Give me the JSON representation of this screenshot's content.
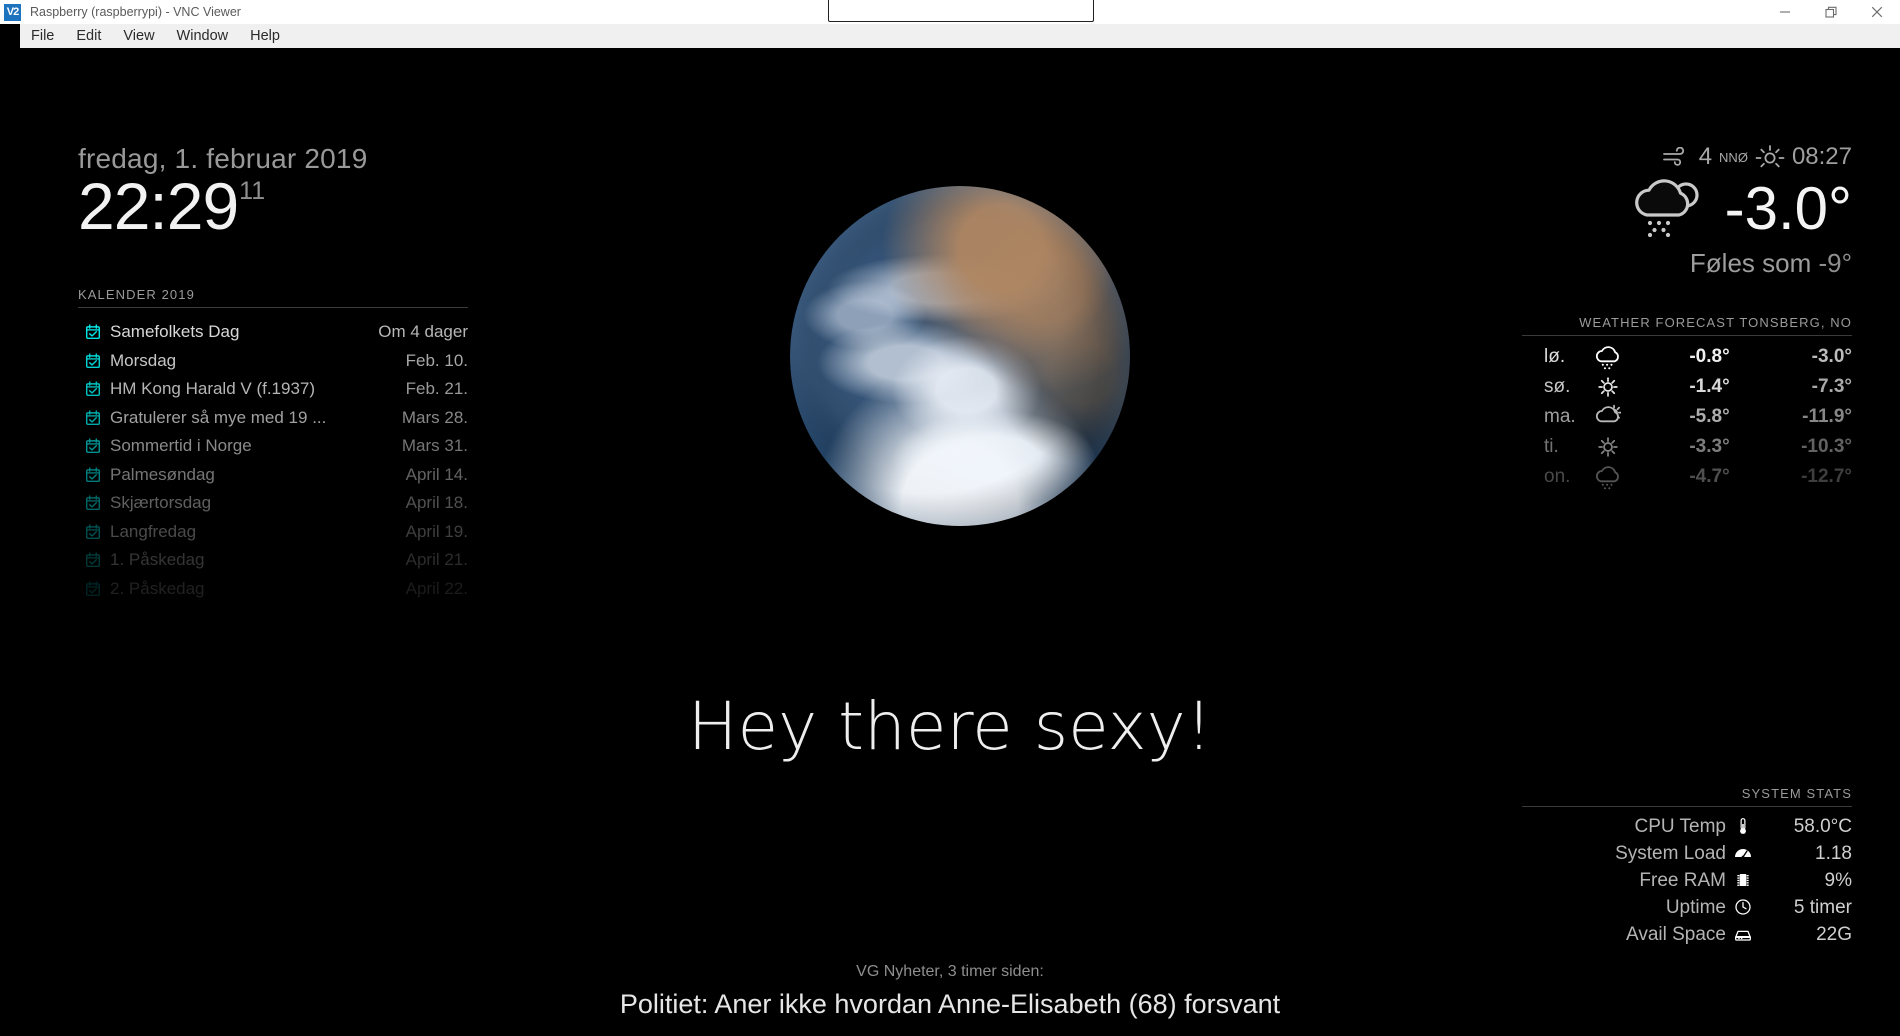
{
  "window": {
    "logo_text": "V2",
    "title": "Raspberry (raspberrypi) - VNC Viewer",
    "controls": {
      "minimize": "minimize-icon",
      "restore": "restore-icon",
      "close": "close-icon"
    },
    "menu": [
      "File",
      "Edit",
      "View",
      "Window",
      "Help"
    ]
  },
  "clock": {
    "date": "fredag, 1. februar 2019",
    "time": "22:29",
    "seconds": "11"
  },
  "calendar": {
    "heading": "KALENDER 2019",
    "events": [
      {
        "title": "Samefolkets Dag",
        "when": "Om 4 dager",
        "opacity": 1.0
      },
      {
        "title": "Morsdag",
        "when": "Feb. 10.",
        "opacity": 0.92
      },
      {
        "title": "HM Kong Harald V (f.1937)",
        "when": "Feb. 21.",
        "opacity": 0.84
      },
      {
        "title": "Gratulerer så mye med 19 ...",
        "when": "Mars 28.",
        "opacity": 0.74
      },
      {
        "title": "Sommertid i Norge",
        "when": "Mars 31.",
        "opacity": 0.64
      },
      {
        "title": "Palmesøndag",
        "when": "April 14.",
        "opacity": 0.54
      },
      {
        "title": "Skjærtorsdag",
        "when": "April 18.",
        "opacity": 0.44
      },
      {
        "title": "Langfredag",
        "when": "April 19.",
        "opacity": 0.34
      },
      {
        "title": "1. Påskedag",
        "when": "April 21.",
        "opacity": 0.24
      },
      {
        "title": "2. Påskedag",
        "when": "April 22.",
        "opacity": 0.15
      }
    ],
    "icon": "calendar-check-icon",
    "icon_color": "#00e5e5"
  },
  "earth": {
    "name": "earth-satellite-image"
  },
  "compliment": {
    "text": "Hey there sexy!"
  },
  "news": {
    "source": "VG Nyheter, 3 timer siden:",
    "headline": "Politiet: Aner ikke hvordan Anne-Elisabeth (68) forsvant"
  },
  "weather": {
    "wind_icon": "wind-icon",
    "wind_speed": "4",
    "wind_direction": "NNØ",
    "sunrise_icon": "sunrise-icon",
    "sunrise_time": "08:27",
    "current_icon": "snow-shower-icon",
    "current_temp": "-3.0°",
    "feels_label": "Føles som",
    "feels_value": "-9°",
    "forecast_heading": "WEATHER FORECAST TONSBERG, NO",
    "forecast": [
      {
        "day": "lø.",
        "icon": "snow-icon",
        "max": "-0.8°",
        "min": "-3.0°",
        "opacity": 1.0
      },
      {
        "day": "sø.",
        "icon": "sun-icon",
        "max": "-1.4°",
        "min": "-7.3°",
        "opacity": 0.9
      },
      {
        "day": "ma.",
        "icon": "partly-sunny-icon",
        "max": "-5.8°",
        "min": "-11.9°",
        "opacity": 0.72
      },
      {
        "day": "ti.",
        "icon": "sun-icon",
        "max": "-3.3°",
        "min": "-10.3°",
        "opacity": 0.52
      },
      {
        "day": "on.",
        "icon": "cloud-snow-icon",
        "max": "-4.7°",
        "min": "-12.7°",
        "opacity": 0.33
      }
    ]
  },
  "system_stats": {
    "heading": "SYSTEM STATS",
    "rows": [
      {
        "label": "CPU Temp",
        "icon": "thermometer-icon",
        "value": "58.0°C"
      },
      {
        "label": "System Load",
        "icon": "gauge-icon",
        "value": "1.18"
      },
      {
        "label": "Free RAM",
        "icon": "memory-icon",
        "value": "9%"
      },
      {
        "label": "Uptime",
        "icon": "clock-icon",
        "value": "5 timer"
      },
      {
        "label": "Avail Space",
        "icon": "harddisk-icon",
        "value": "22G"
      }
    ]
  }
}
